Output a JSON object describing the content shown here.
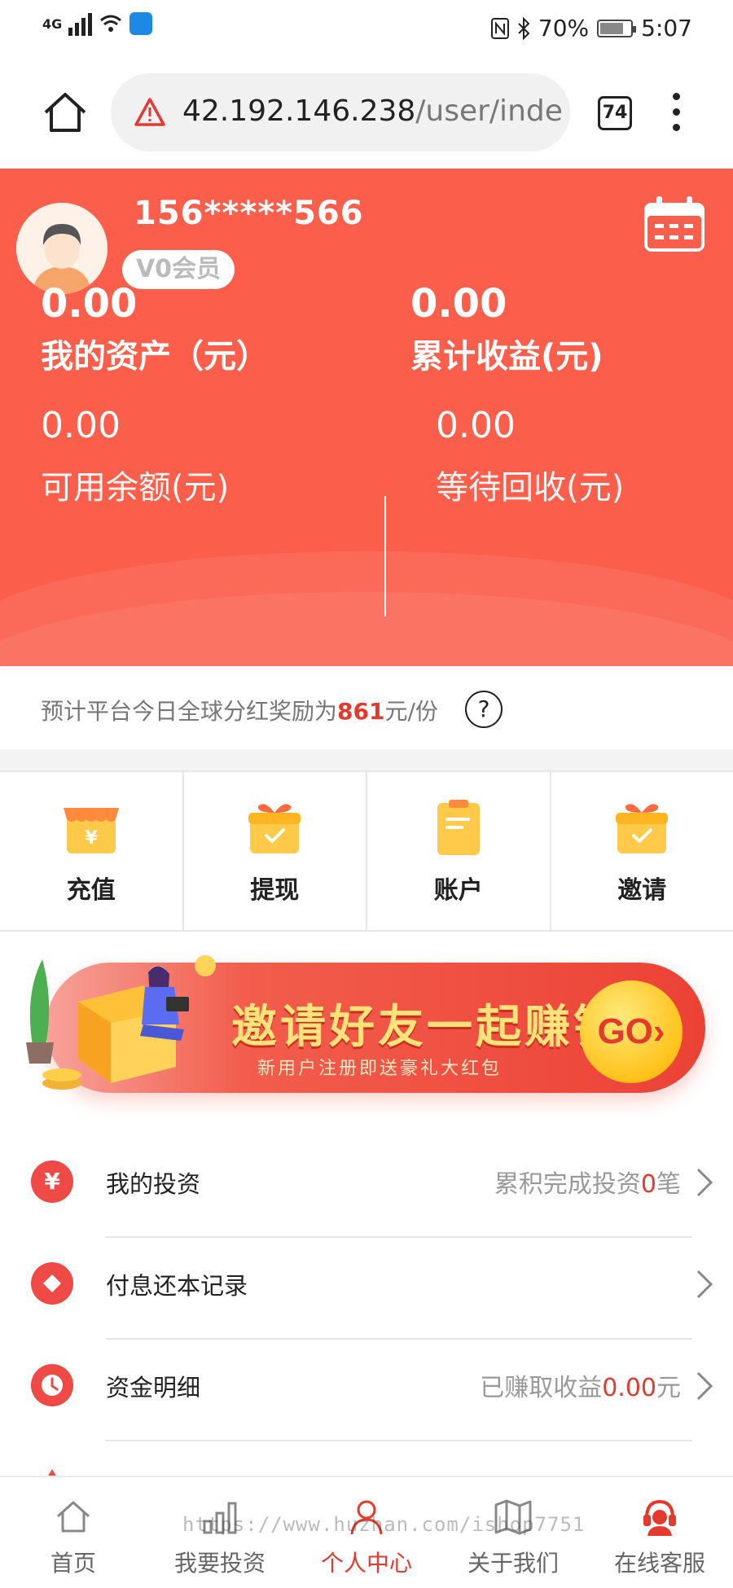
{
  "status_bar": {
    "network": "4G",
    "battery": "70%",
    "time": "5:07"
  },
  "browser": {
    "url_host": "42.192.146.238",
    "url_path": "/user/inde",
    "tab_count": "74"
  },
  "profile": {
    "username": "156*****566",
    "member_level": "V0会员"
  },
  "stats": {
    "assets_value": "0.00",
    "assets_label": "我的资产（元）",
    "earnings_value": "0.00",
    "earnings_label": "累计收益(元)",
    "available_value": "0.00",
    "available_label": "可用余额(元)",
    "pending_value": "0.00",
    "pending_label": "等待回收(元)"
  },
  "notice": {
    "prefix": "预计平台今日全球分红奖励为",
    "amount": "861",
    "suffix": "元/份",
    "help": "?"
  },
  "actions": [
    {
      "label": "充值",
      "icon": "shop-icon"
    },
    {
      "label": "提现",
      "icon": "gift-icon"
    },
    {
      "label": "账户",
      "icon": "document-icon"
    },
    {
      "label": "邀请",
      "icon": "gift-icon"
    }
  ],
  "banner": {
    "title": "邀请好友一起赚钱",
    "subtitle": "新用户注册即送豪礼大红包",
    "go": "GO›"
  },
  "list": [
    {
      "label": "我的投资",
      "icon": "yen-icon",
      "glyph": "¥",
      "value_prefix": "累积完成投资",
      "value_hl": "0",
      "value_suffix": "笔"
    },
    {
      "label": "付息还本记录",
      "icon": "diamond-icon",
      "glyph": "◆",
      "value_prefix": "",
      "value_hl": "",
      "value_suffix": ""
    },
    {
      "label": "资金明细",
      "icon": "clock-icon",
      "glyph": "",
      "value_prefix": "已赚取收益",
      "value_hl": "0.00",
      "value_suffix": "元"
    }
  ],
  "nav": [
    {
      "label": "首页",
      "icon": "home-icon"
    },
    {
      "label": "我要投资",
      "icon": "bar-chart-icon"
    },
    {
      "label": "个人中心",
      "icon": "person-icon"
    },
    {
      "label": "关于我们",
      "icon": "map-icon"
    },
    {
      "label": "在线客服",
      "icon": "headset-icon"
    }
  ],
  "watermark": "https://www.huzhan.com/ishop7751",
  "colors": {
    "header_red": "#fb5e4a",
    "accent_red": "#e23b2e",
    "icon_orange": "#ffb51f"
  }
}
